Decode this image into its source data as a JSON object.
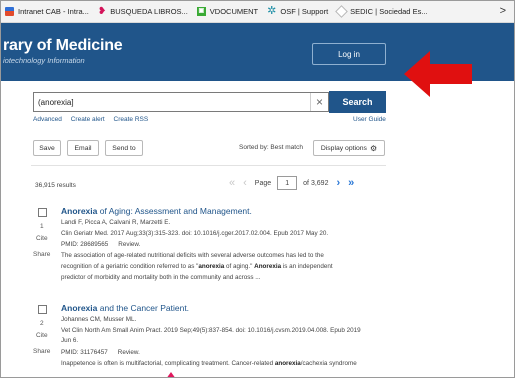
{
  "bookmarks": [
    {
      "label": "Intranet CAB - Intra...",
      "icon": "cab-icon"
    },
    {
      "label": "BUSQUEDA LIBROS...",
      "icon": "busqueda-icon"
    },
    {
      "label": "VDOCUMENT",
      "icon": "vdocument-icon"
    },
    {
      "label": "OSF | Support",
      "icon": "osf-icon"
    },
    {
      "label": "SEDIC | Sociedad Es...",
      "icon": "sedic-icon"
    }
  ],
  "bookmarks_more": ">",
  "header": {
    "title": "rary of Medicine",
    "subtitle": "iotechnology Information",
    "login_label": "Log in",
    "bg_color": "#20558a",
    "arrow_color": "#e01010"
  },
  "search": {
    "value": "(anorexia]",
    "clear": "×",
    "button": "Search",
    "links": [
      "Advanced",
      "Create alert",
      "Create RSS"
    ],
    "user_guide": "User Guide"
  },
  "toolbar": {
    "save": "Save",
    "email": "Email",
    "send_to": "Send to",
    "sorted": "Sorted by: Best match",
    "display_options": "Display options"
  },
  "results_meta": {
    "count": "36,915 results",
    "page_label": "Page",
    "page": "1",
    "of_pages": "of 3,692"
  },
  "results": [
    {
      "number": "1",
      "cite": "Cite",
      "share": "Share",
      "title_bold": "Anorexia",
      "title_rest": " of Aging: Assessment and Management.",
      "authors": "Landi F, Picca A, Calvani R, Marzetti E.",
      "citation": "Clin Geriatr Med. 2017 Aug;33(3):315-323. doi: 10.1016/j.cger.2017.02.004. Epub 2017 May 20.",
      "citation2": "",
      "pmid": "PMID: 28689565",
      "type": "Review.",
      "snippet": [
        "The association of age-related nutritional deficits with several adverse outcomes has led to the",
        "recognition of a geriatric condition referred to as \"anorexia of aging.\" Anorexia is an independent",
        "predictor of morbidity and mortality both in the community and across ..."
      ]
    },
    {
      "number": "2",
      "cite": "Cite",
      "share": "Share",
      "title_bold": "Anorexia",
      "title_rest": " and the Cancer Patient.",
      "authors": "Johannes CM, Musser ML.",
      "citation": "Vet Clin North Am Small Anim Pract. 2019 Sep;49(5):837-854. doi: 10.1016/j.cvsm.2019.04.008. Epub 2019",
      "citation2": "Jun 6.",
      "pmid": "PMID: 31176457",
      "type": "Review.",
      "snippet": [
        "Inappetence is often is multifactorial, complicating treatment. Cancer-related anorexia/cachexia syndrome"
      ]
    }
  ]
}
